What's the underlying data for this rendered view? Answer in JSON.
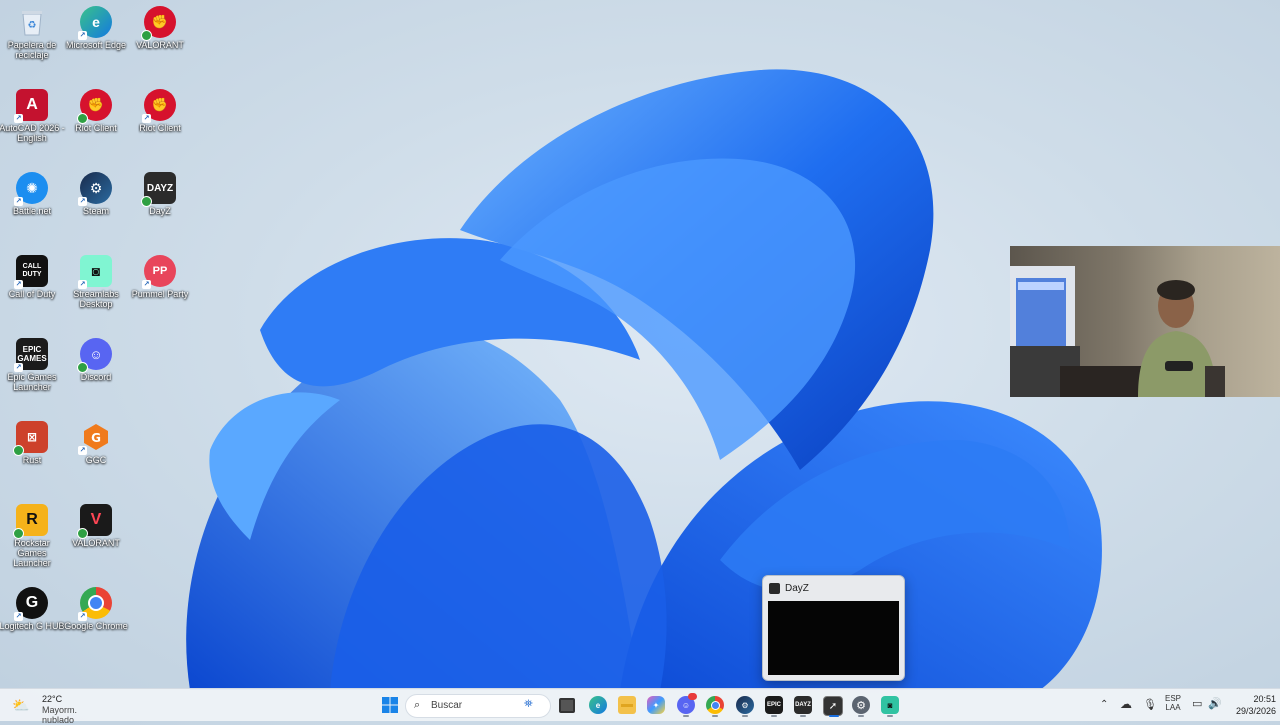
{
  "desktop": {
    "icons": [
      {
        "label": "Papelera de reciclaje",
        "icon": "recycle-bin-icon"
      },
      {
        "label": "Microsoft Edge",
        "icon": "edge-icon"
      },
      {
        "label": "VALORANT",
        "icon": "riot-icon"
      },
      {
        "label": "AutoCAD 2026 - English",
        "icon": "autocad-icon",
        "badge": "CAD"
      },
      {
        "label": "Riot Client",
        "icon": "riot-icon"
      },
      {
        "label": "Riot Client",
        "icon": "riot-icon"
      },
      {
        "label": "Battle.net",
        "icon": "battlenet-icon"
      },
      {
        "label": "Steam",
        "icon": "steam-icon"
      },
      {
        "label": "DayZ",
        "icon": "dayz-icon",
        "badge": "DAYZ"
      },
      {
        "label": "Call of Duty",
        "icon": "call-of-duty-icon",
        "badge": "CALL OF DUTY"
      },
      {
        "label": "Streamlabs Desktop",
        "icon": "streamlabs-icon"
      },
      {
        "label": "Pummel Party",
        "icon": "pummel-party-icon",
        "badge": "PP"
      },
      {
        "label": "Epic Games Launcher",
        "icon": "epic-games-icon",
        "badge": "EPIC GAMES"
      },
      {
        "label": "Discord",
        "icon": "discord-icon"
      },
      {
        "label": "Rust",
        "icon": "rust-icon"
      },
      {
        "label": "GGC",
        "icon": "ggc-icon"
      },
      {
        "label": "Rockstar Games Launcher",
        "icon": "rockstar-icon",
        "badge": "R"
      },
      {
        "label": "VALORANT",
        "icon": "valorant-icon"
      },
      {
        "label": "Logitech G HUB",
        "icon": "logitech-ghub-icon",
        "badge": "G"
      },
      {
        "label": "Google Chrome",
        "icon": "chrome-icon"
      }
    ]
  },
  "preview": {
    "title": "DayZ"
  },
  "taskbar": {
    "weather": {
      "temp": "22°C",
      "desc": "Mayorm. nublado"
    },
    "search_placeholder": "Buscar",
    "tray": {
      "lang": "ESP",
      "layout": "LAA",
      "time": "20:51",
      "date": "29/3/2026"
    }
  },
  "colors": {
    "accent": "#1565e8",
    "taskbar": "#eef2f7"
  }
}
